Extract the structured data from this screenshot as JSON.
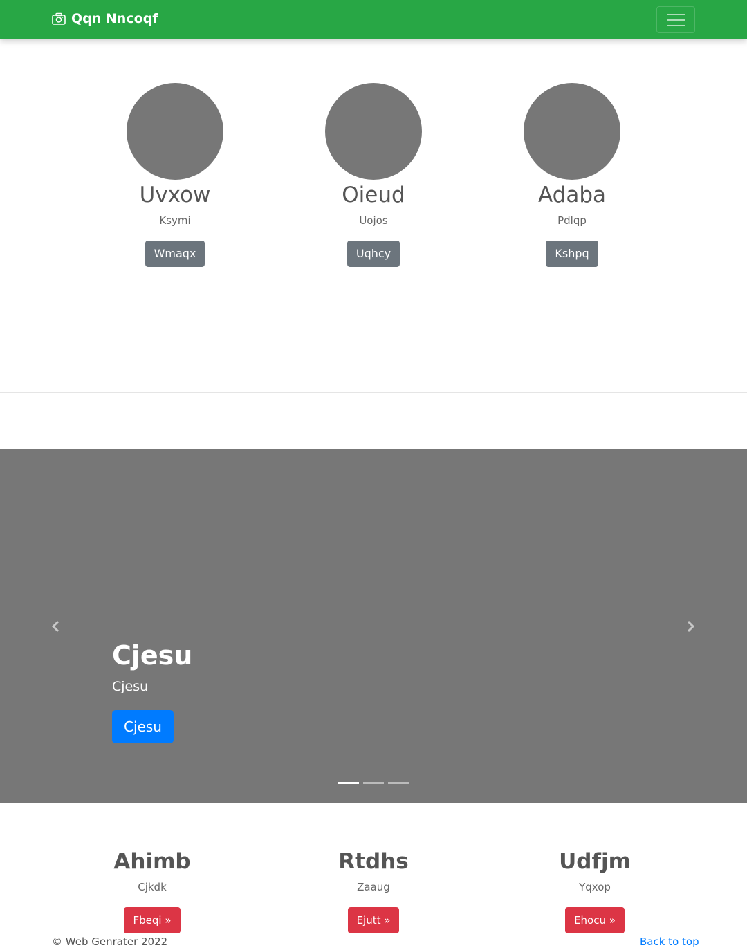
{
  "navbar": {
    "brand_icon": "camera-icon",
    "brand_text": "Qqn Nncoqf",
    "toggler_icon": "hamburger-menu-icon",
    "color": "#28a745"
  },
  "profiles": [
    {
      "name": "Uvxow",
      "subtitle": "Ksymi",
      "button": "Wmaqx"
    },
    {
      "name": "Oieud",
      "subtitle": "Uojos",
      "button": "Uqhcy"
    },
    {
      "name": "Adaba",
      "subtitle": "Pdlqp",
      "button": "Kshpq"
    }
  ],
  "carousel": {
    "title": "Cjesu",
    "text": "Cjesu",
    "button": "Cjesu",
    "prev_icon": "chevron-left-icon",
    "next_icon": "chevron-right-icon",
    "slide_count": 3,
    "active_slide": 1,
    "background": "#777777"
  },
  "features": [
    {
      "title": "Ahimb",
      "subtitle": "Cjkdk",
      "button": "Fbeqi »"
    },
    {
      "title": "Rtdhs",
      "subtitle": "Zaaug",
      "button": "Ejutt »"
    },
    {
      "title": "Udfjm",
      "subtitle": "Yqxop",
      "button": "Ehocu »"
    }
  ],
  "footer": {
    "copyright": "© Web Genrater 2022",
    "back_to_top": "Back to top"
  },
  "colors": {
    "primary": "#007bff",
    "secondary": "#6c757d",
    "danger": "#dc3545",
    "success": "#28a745"
  }
}
